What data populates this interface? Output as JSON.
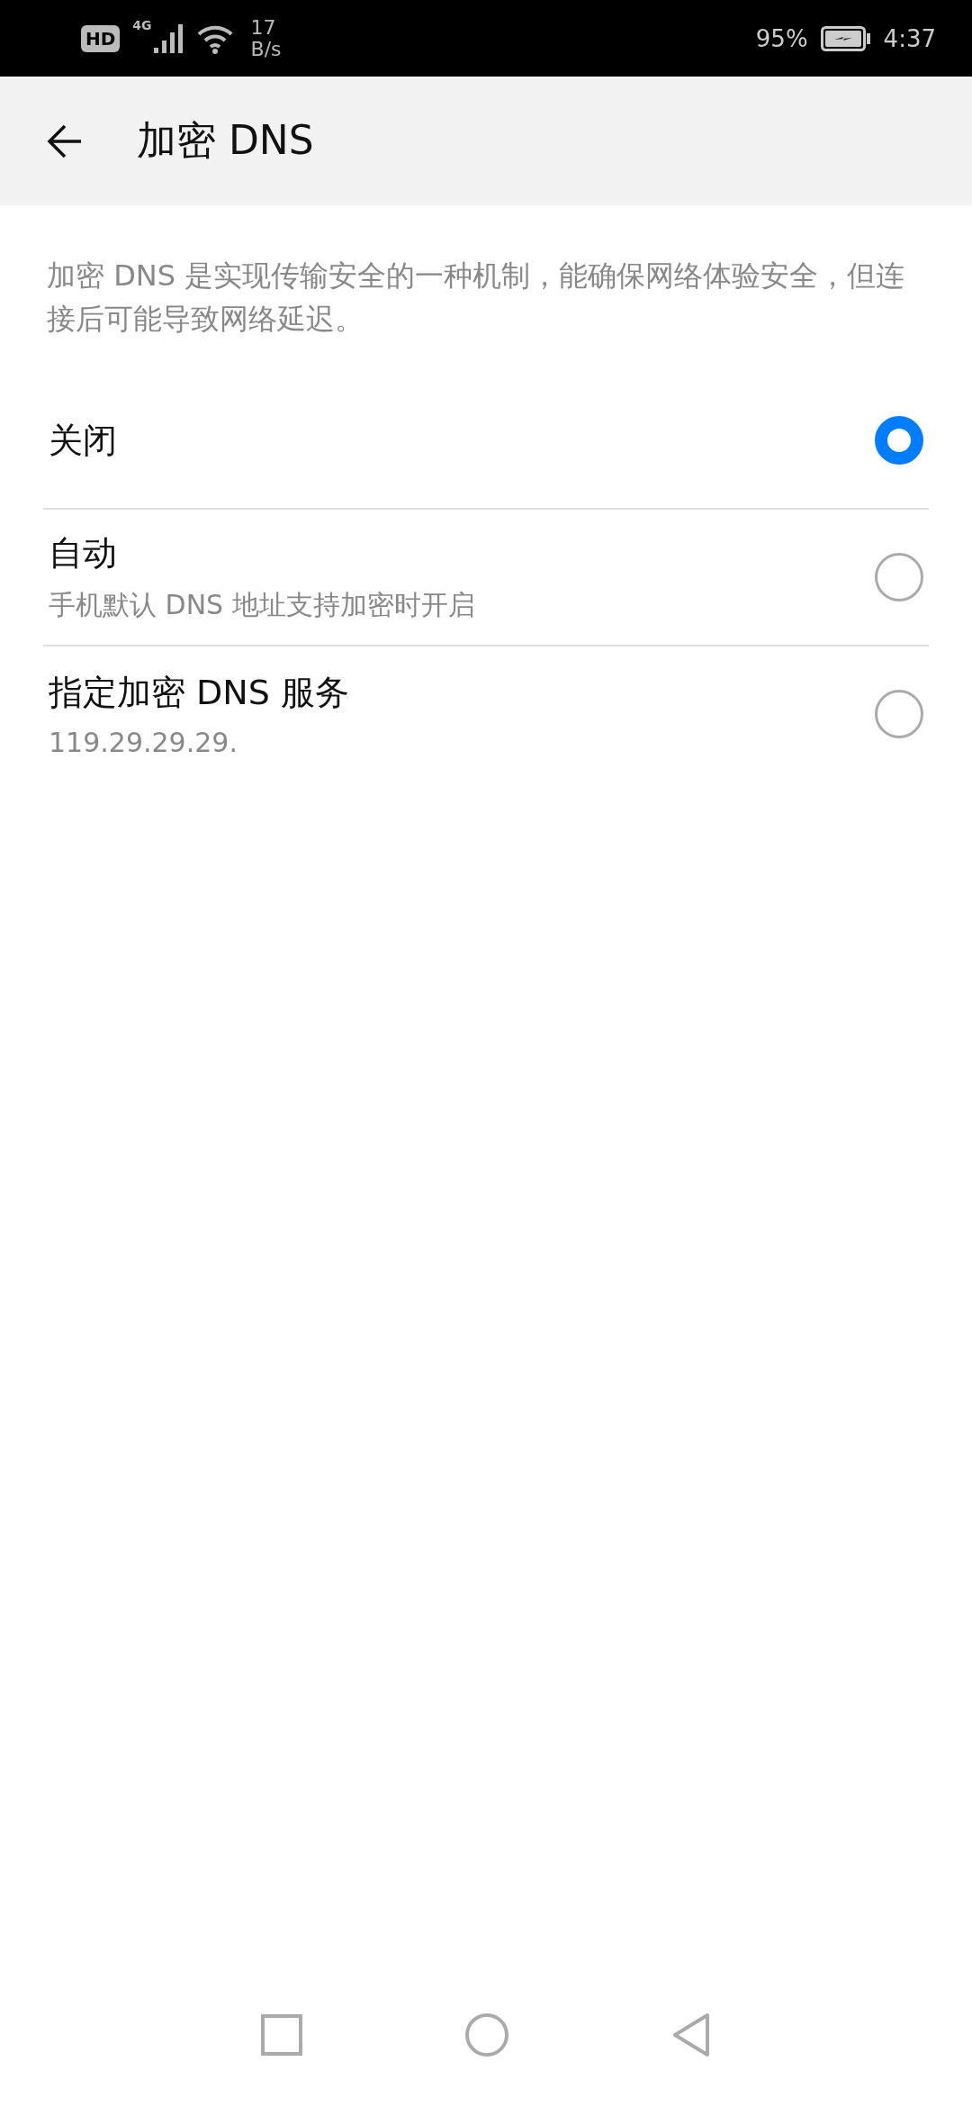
{
  "status_bar": {
    "hd_badge": "HD",
    "network_type": "4G",
    "speed_value": "17",
    "speed_unit": "B/s",
    "battery_percent": "95%",
    "time": "4:37"
  },
  "header": {
    "title": "加密 DNS"
  },
  "description": "加密 DNS 是实现传输安全的一种机制，能确保网络体验安全，但连接后可能导致网络延迟。",
  "options": [
    {
      "label": "关闭",
      "selected": true
    },
    {
      "label": "自动",
      "subtitle": "手机默认 DNS 地址支持加密时开启",
      "selected": false
    },
    {
      "label": "指定加密 DNS 服务",
      "subtitle": "119.29.29.29.",
      "selected": false
    }
  ]
}
